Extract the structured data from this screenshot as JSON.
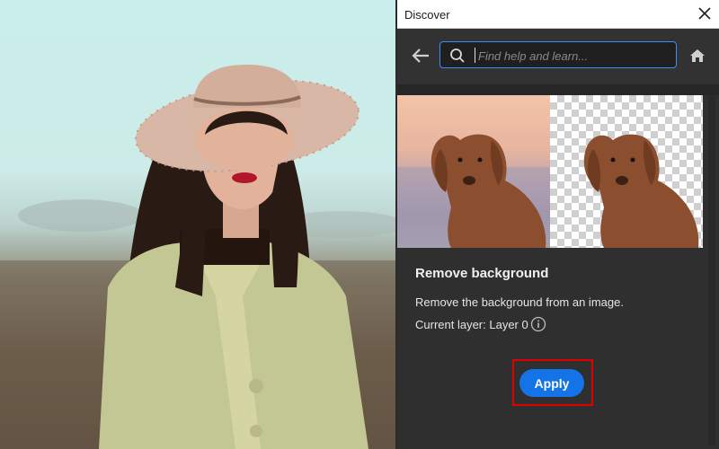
{
  "panel": {
    "title": "Discover",
    "search": {
      "placeholder": "Find help and learn..."
    },
    "feature": {
      "title": "Remove background",
      "description": "Remove the background from an image.",
      "current_layer": "Current layer: Layer 0",
      "apply_label": "Apply"
    }
  },
  "colors": {
    "accent": "#1473e6",
    "highlight": "#e00000",
    "panel_bg": "#2f2f2f"
  },
  "icons": [
    "close-icon",
    "back-arrow-icon",
    "search-icon",
    "home-icon",
    "info-icon"
  ]
}
